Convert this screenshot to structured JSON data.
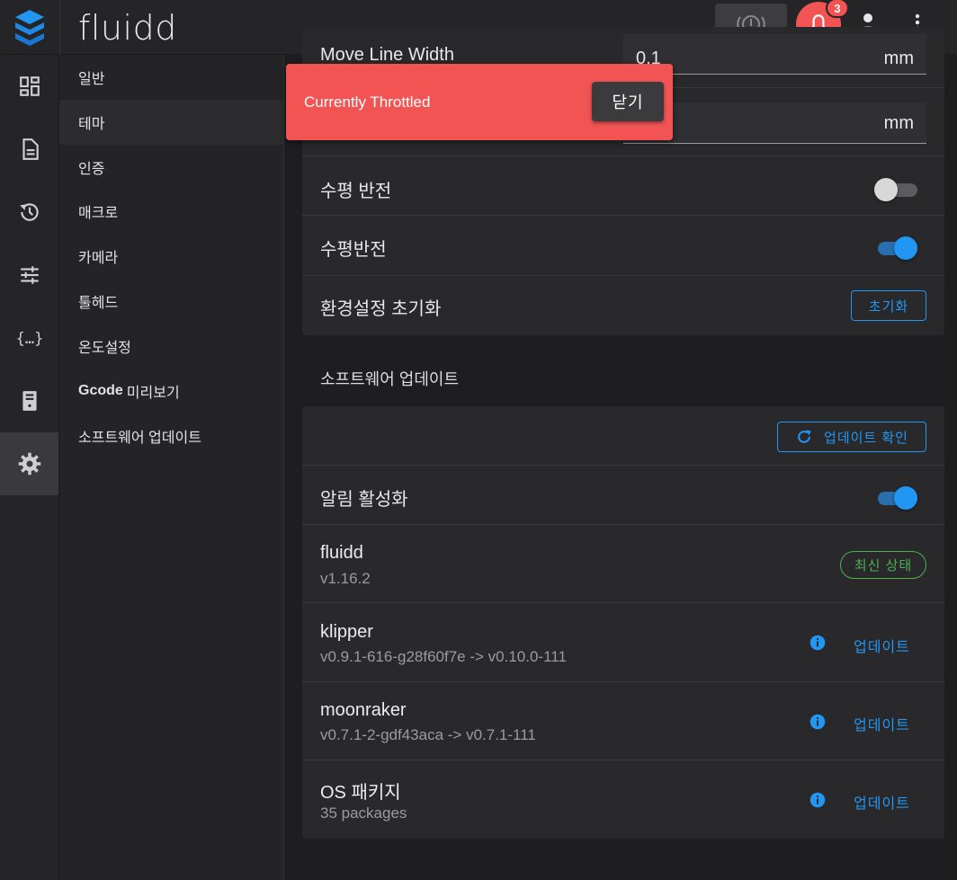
{
  "app": {
    "brand": "fluidd",
    "notification_count": "3"
  },
  "colors": {
    "accent": "#2196f3",
    "danger": "#f25454",
    "success": "#4caf50"
  },
  "rail": {
    "items": [
      {
        "icon": "dashboard-icon"
      },
      {
        "icon": "file-document-icon"
      },
      {
        "icon": "history-icon"
      },
      {
        "icon": "tune-icon"
      },
      {
        "icon": "code-braces-icon"
      },
      {
        "icon": "server-icon"
      },
      {
        "icon": "gear-icon",
        "active": true
      }
    ]
  },
  "subnav": {
    "items": [
      {
        "label": "일반"
      },
      {
        "label": "테마"
      },
      {
        "label": "인증"
      },
      {
        "label": "매크로"
      },
      {
        "label": "카메라"
      },
      {
        "label": "툴헤드"
      },
      {
        "label": "온도설정"
      },
      {
        "bold": "Gcode",
        "label": "미리보기"
      },
      {
        "label": "소프트웨어 업데이트"
      }
    ]
  },
  "preview": {
    "move_line_width_label": "Move Line Width",
    "move_line_width_value": "0.1",
    "unit": "mm",
    "flip_h_label": "수평 반전",
    "flip_h_on": false,
    "flip_v_label": "수평반전",
    "flip_v_on": true,
    "reset_label": "환경설정 초기화",
    "reset_button": "초기화"
  },
  "updates": {
    "section_title": "소프트웨어 업데이트",
    "check_button": "업데이트 확인",
    "notify_label": "알림 활성화",
    "notify_on": true,
    "components": [
      {
        "name": "fluidd",
        "version": "v1.16.2",
        "status": "최신 상태"
      },
      {
        "name": "klipper",
        "version": "v0.9.1-616-g28f60f7e -> v0.10.0-111",
        "action": "업데이트"
      },
      {
        "name": "moonraker",
        "version": "v0.7.1-2-gdf43aca -> v0.7.1-111",
        "action": "업데이트"
      },
      {
        "name": "OS 패키지",
        "version": "35 packages",
        "action": "업데이트"
      }
    ]
  },
  "snackbar": {
    "message": "Currently Throttled",
    "close_label": "닫기"
  }
}
